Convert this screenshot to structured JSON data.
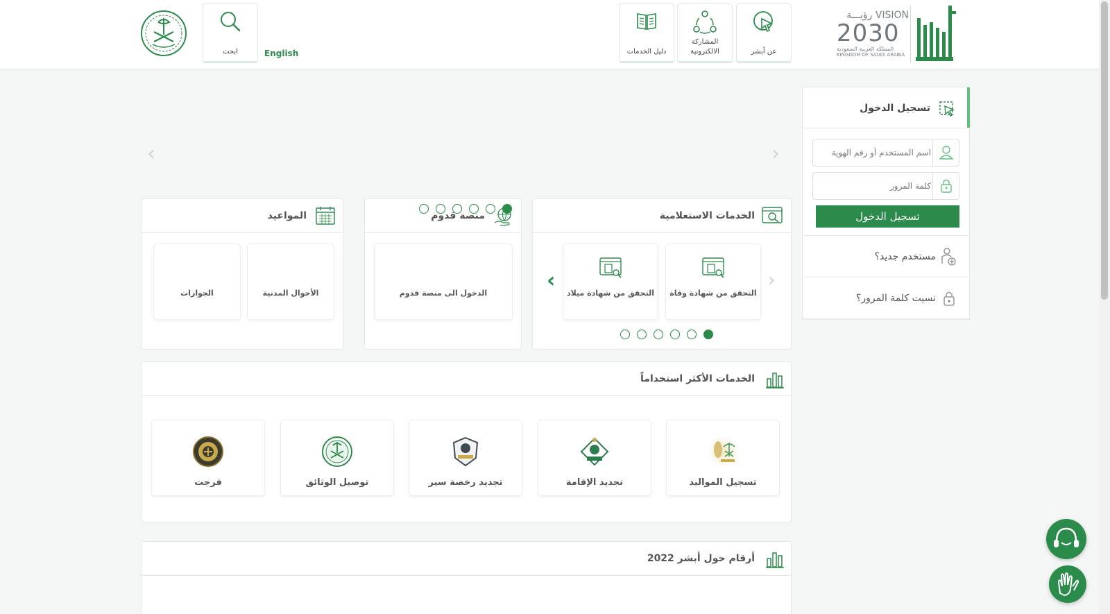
{
  "header": {
    "nav": [
      {
        "label": "عن أبشر",
        "icon": "cursor-click-icon"
      },
      {
        "label": "المشاركة الالكترونية",
        "icon": "share-network-icon"
      },
      {
        "label": "دليل الخدمات",
        "icon": "open-book-icon"
      }
    ],
    "english_label": "English",
    "search_label": "ابحث",
    "vision": {
      "line1": "رؤيـــة VISION",
      "number": "2030",
      "line3": "المملكة العربية السعودية",
      "line4": "KINGDOM OF SAUDI ARABIA"
    }
  },
  "inquiry": {
    "title": "الخدمات الاستعلامية",
    "items": [
      "التحقق من شهادة وفاة",
      "التحقق من شهادة ميلاد"
    ],
    "dots_total": 6,
    "dots_active": 0
  },
  "qudoom": {
    "title": "منصة قدوم",
    "items": [
      "الدخول الى منصة قدوم"
    ],
    "dots_total": 6,
    "dots_active": 0
  },
  "appointments": {
    "title": "المواعيد",
    "items": [
      "الأحوال المدنية",
      "الجوازات"
    ]
  },
  "most_used": {
    "title": "الخدمات الأكثر استخداماً",
    "items": [
      {
        "label": "تسجيل المواليد",
        "color": "#c9a94a"
      },
      {
        "label": "تجديد الإقامة",
        "color": "#2e7d4f"
      },
      {
        "label": "تجديد رخصة سير",
        "color": "#3f4a52"
      },
      {
        "label": "توصيل الوثائق",
        "color": "#2a8b4a"
      },
      {
        "label": "فرجت",
        "color": "#8a6b2a"
      }
    ]
  },
  "numbers": {
    "title": "أرقام حول أبشر 2022"
  },
  "login": {
    "title": "تسجيل الدخول",
    "username_placeholder": "اسم المستخدم أو رقم الهوية",
    "password_placeholder": "كلمة المرور",
    "submit_label": "تسجيل الدخول",
    "new_user": "مستخدم جديد؟",
    "forgot": "نسيت كلمة المرور؟"
  },
  "colors": {
    "brand": "#2a8b4a",
    "accent": "#63c07a"
  }
}
